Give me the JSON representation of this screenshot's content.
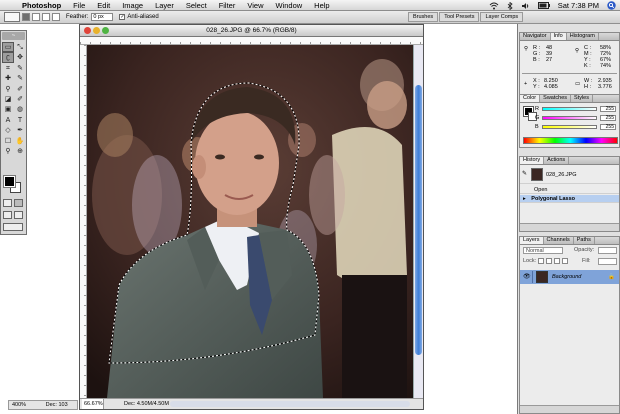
{
  "menubar": {
    "app_name": "Photoshop",
    "menus": [
      "File",
      "Edit",
      "Image",
      "Layer",
      "Select",
      "Filter",
      "View",
      "Window",
      "Help"
    ],
    "clock": "Sat 7:38 PM"
  },
  "options": {
    "feather_label": "Feather:",
    "feather_value": "0 px",
    "antialias_label": "Anti-aliased",
    "well_tabs": [
      "Brushes",
      "Tool Presets",
      "Layer Comps"
    ]
  },
  "document": {
    "title": "028_26.JPG @ 66.7% (RGB/8)",
    "zoom": "66.67%",
    "doc_size": "Dec: 4.50M/4.50M"
  },
  "background_doc": {
    "zoom": "400%",
    "doc_size": "Dec: 103"
  },
  "navigator": {
    "tabs": [
      "Navigator",
      "Info",
      "Histogram"
    ],
    "active_tab": "Info",
    "r": "48",
    "g": "39",
    "b": "27",
    "c": "58%",
    "m": "72%",
    "y": "67%",
    "k": "74%",
    "x": "8.250",
    "y_pos": "4.085",
    "w": "2.935",
    "h": "3.776"
  },
  "color": {
    "tabs": [
      "Color",
      "Swatches",
      "Styles"
    ],
    "r": "255",
    "g": "255",
    "b": "255"
  },
  "history": {
    "tabs": [
      "History",
      "Actions"
    ],
    "snapshot": "028_26.JPG",
    "steps": [
      "Open",
      "Polygonal Lasso"
    ]
  },
  "layers": {
    "tabs": [
      "Layers",
      "Channels",
      "Paths"
    ],
    "blend_mode": "Normal",
    "opacity_label": "Opacity:",
    "lock_label": "Lock:",
    "fill_label": "Fill:",
    "layer_name": "Background"
  },
  "toolbox": {
    "tools": [
      "▭",
      "⤡",
      "ʗ",
      "✥",
      "⌗",
      "✎",
      "✚",
      "✎",
      "⚲",
      "✐",
      "◪",
      "✐",
      "▣",
      "◍",
      "A",
      "T",
      "◇",
      "✒",
      "☐",
      "✋",
      "⚲",
      "⊕"
    ]
  }
}
